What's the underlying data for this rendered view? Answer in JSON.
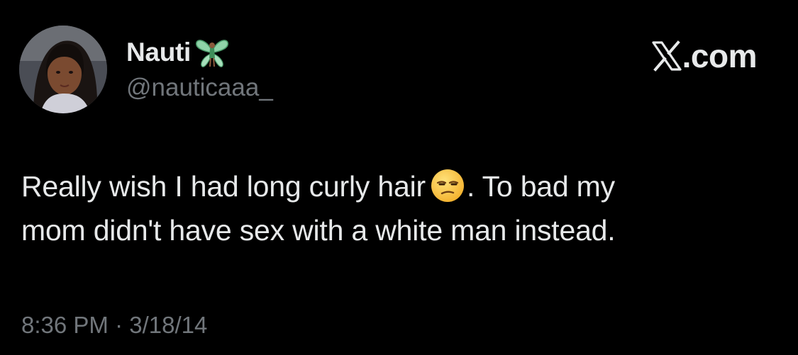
{
  "tweet": {
    "author": {
      "display_name": "Nauti",
      "name_emoji_icon": "fairy-icon",
      "handle": "@nauticaaa_"
    },
    "brand": {
      "logo_icon": "x-logo-icon",
      "suffix": ".com"
    },
    "text": {
      "before_emoji": "Really wish I had long curly hair",
      "emoji_icon": "unamused-face-emoji-icon",
      "after_emoji_line1": ". To bad my",
      "line2": "mom didn't have sex with a white man instead."
    },
    "timestamp": "8:36 PM · 3/18/14"
  },
  "colors": {
    "background": "#000000",
    "primary_text": "#e7e9ea",
    "secondary_text": "#71767b"
  }
}
